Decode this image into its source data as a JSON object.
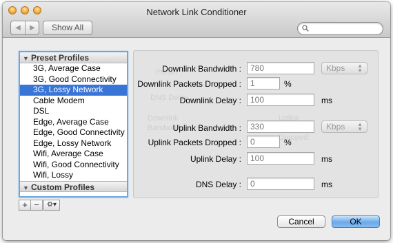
{
  "window": {
    "title": "Network Link Conditioner"
  },
  "toolbar": {
    "back_glyph": "◀",
    "forward_glyph": "▶",
    "show_all_label": "Show All",
    "search_placeholder": ""
  },
  "profiles": {
    "preset_header": "Preset Profiles",
    "items": [
      "3G, Average Case",
      "3G, Good Connectivity",
      "3G, Lossy Network",
      "Cable Modem",
      "DSL",
      "Edge, Average Case",
      "Edge, Good Connectivity",
      "Edge, Lossy Network",
      "Wifi, Average Case",
      "Wifi, Good Connectivity",
      "Wifi, Lossy"
    ],
    "selected": "3G, Lossy Network",
    "custom_header": "Custom Profiles",
    "header_triangle": "▼",
    "add_label": "+",
    "remove_label": "−",
    "action_label": "⚙▾"
  },
  "settings": {
    "downlink_bandwidth": {
      "label": "Downlink Bandwidth :",
      "value": "780",
      "unit": "Kbps"
    },
    "downlink_packets_dropped": {
      "label": "Downlink Packets Dropped :",
      "value": "1",
      "unit": "%"
    },
    "downlink_delay": {
      "label": "Downlink Delay :",
      "value": "100",
      "unit": "ms"
    },
    "uplink_bandwidth": {
      "label": "Uplink Bandwidth :",
      "value": "330",
      "unit": "Kbps"
    },
    "uplink_packets_dropped": {
      "label": "Uplink Packets Dropped :",
      "value": "0",
      "unit": "%"
    },
    "uplink_delay": {
      "label": "Uplink Delay :",
      "value": "100",
      "unit": "ms"
    },
    "dns_delay": {
      "label": "DNS Delay :",
      "value": "0",
      "unit": "ms"
    }
  },
  "footer": {
    "cancel_label": "Cancel",
    "ok_label": "OK"
  },
  "colors": {
    "selection": "#3875d7",
    "ok_button": "#6aa9ea",
    "focus_ring": "#6ea7df"
  }
}
